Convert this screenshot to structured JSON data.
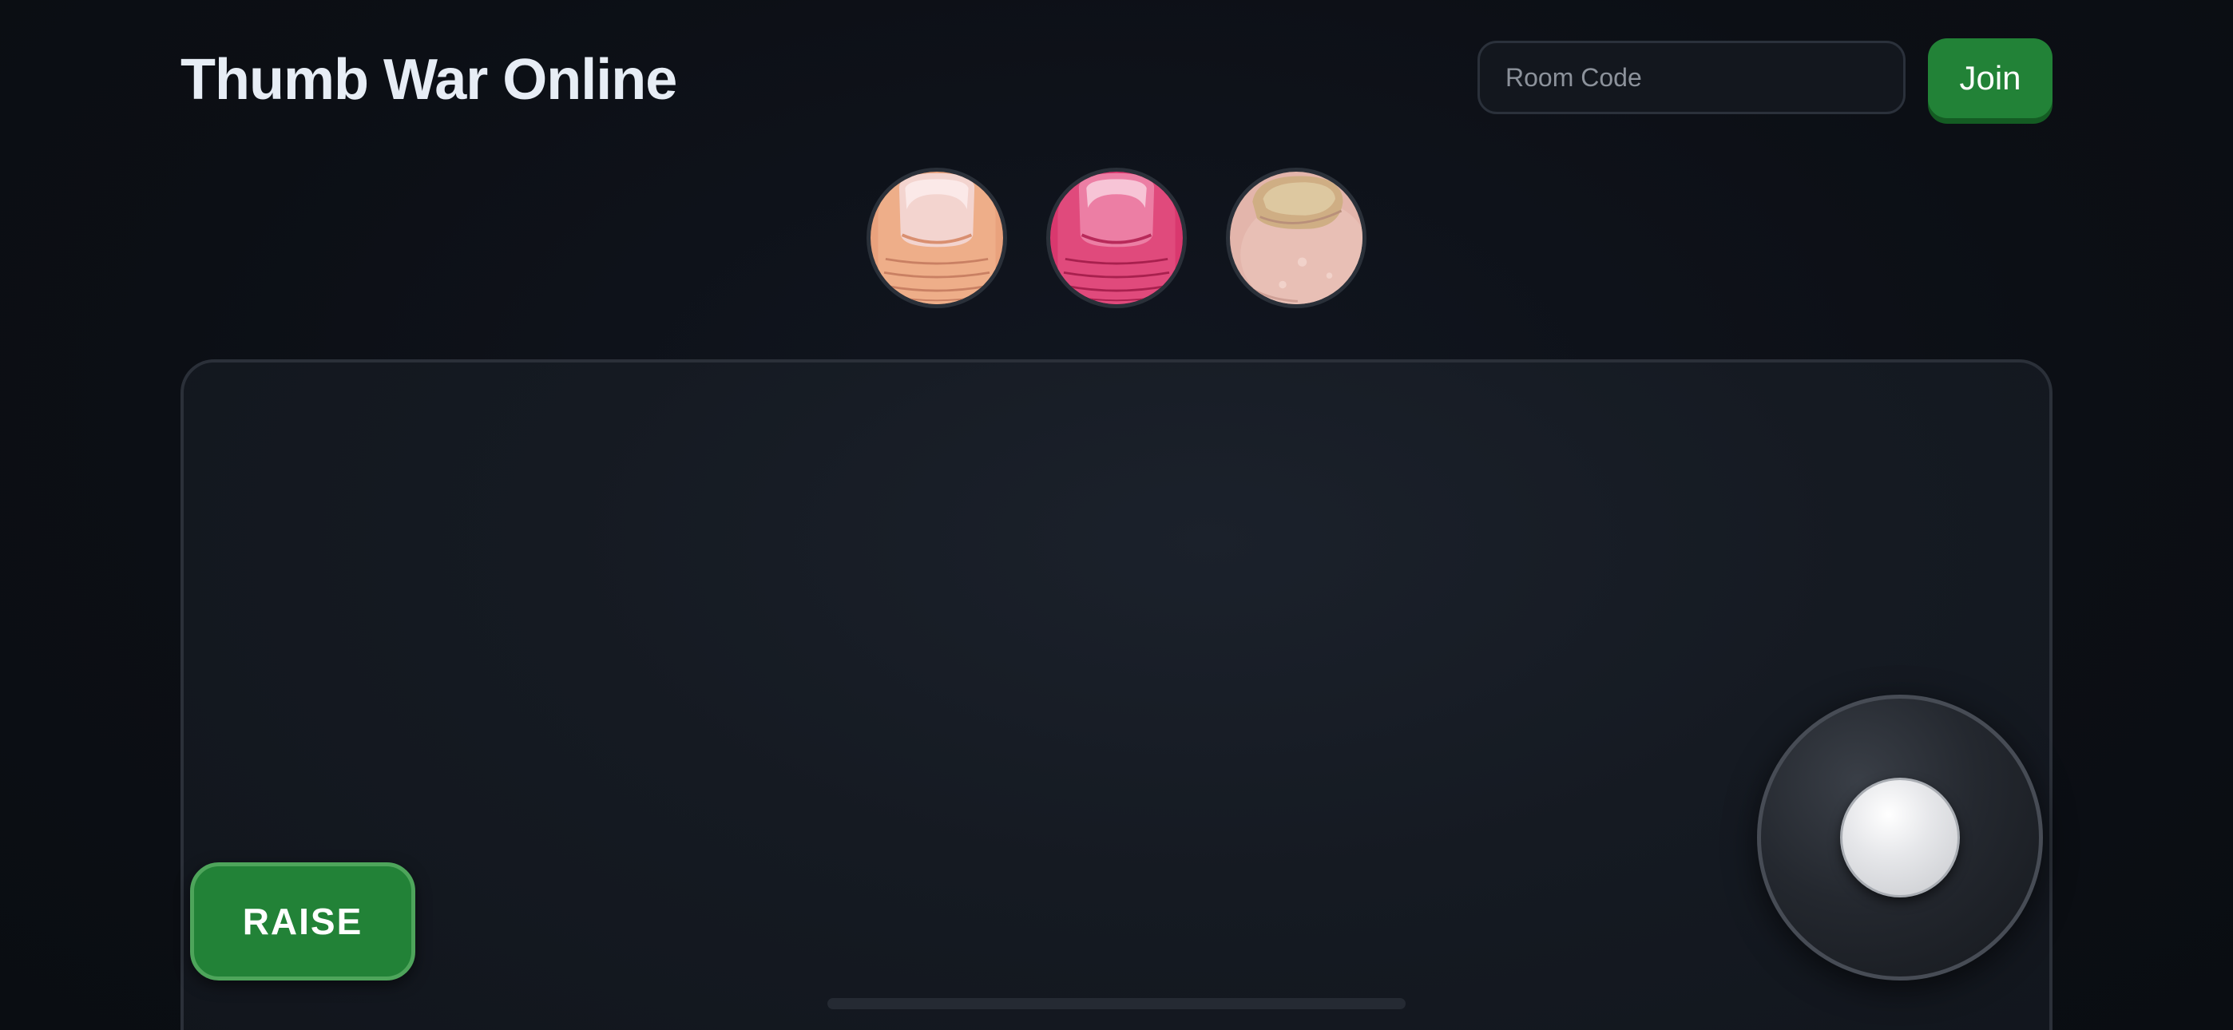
{
  "header": {
    "title": "Thumb War Online"
  },
  "room": {
    "placeholder": "Room Code",
    "value": "",
    "join_label": "Join"
  },
  "skins": [
    {
      "icon": "thumb-natural-icon"
    },
    {
      "icon": "thumb-pink-polish-icon"
    },
    {
      "icon": "toe-nail-icon"
    }
  ],
  "controls": {
    "raise_label": "RAISE",
    "joystick_icon": "joystick-icon"
  },
  "colors": {
    "background": "#0c0f15",
    "accent_green": "#228237",
    "arena_border": "#2b3039",
    "title_text": "#e7edf5"
  }
}
